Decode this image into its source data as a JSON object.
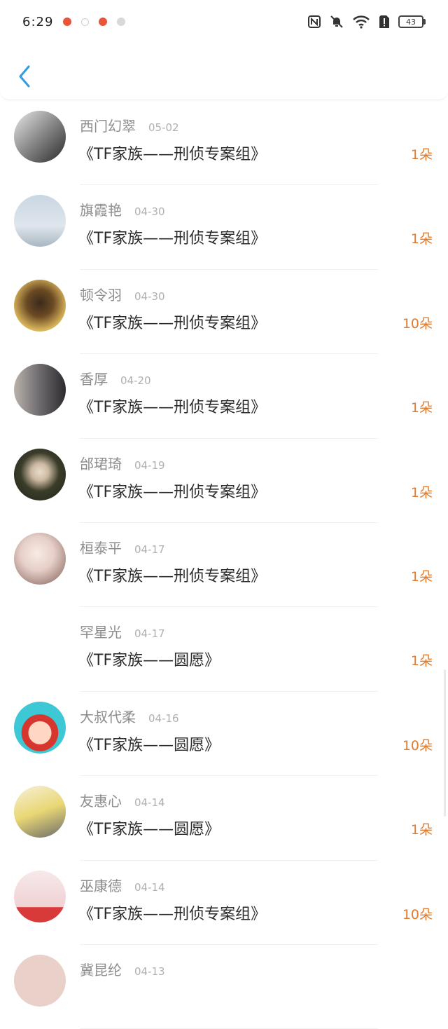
{
  "status_bar": {
    "time": "6:29",
    "battery": "43"
  },
  "entries": [
    {
      "name": "西门幻翠",
      "date": "05-02",
      "title": "《TF家族——刑侦专案组》",
      "count": "1朵",
      "avatar_color": "#3a3a3a",
      "avatar_style": "photo-bw"
    },
    {
      "name": "旗霞艳",
      "date": "04-30",
      "title": "《TF家族——刑侦专案组》",
      "count": "1朵",
      "avatar_color": "#c9d6e3",
      "avatar_style": "sky"
    },
    {
      "name": "顿令羽",
      "date": "04-30",
      "title": "《TF家族——刑侦专案组》",
      "count": "10朵",
      "avatar_color": "#c59a3e",
      "avatar_style": "gold"
    },
    {
      "name": "香厚",
      "date": "04-20",
      "title": "《TF家族——刑侦专案组》",
      "count": "1朵",
      "avatar_color": "#6d6a6e",
      "avatar_style": "street"
    },
    {
      "name": "邰珺琦",
      "date": "04-19",
      "title": "《TF家族——刑侦专案组》",
      "count": "1朵",
      "avatar_color": "#2f3324",
      "avatar_style": "dark"
    },
    {
      "name": "桓泰平",
      "date": "04-17",
      "title": "《TF家族——刑侦专案组》",
      "count": "1朵",
      "avatar_color": "#e8d9d5",
      "avatar_style": "light"
    },
    {
      "name": "罕星光",
      "date": "04-17",
      "title": "《TF家族——圆愿》",
      "count": "1朵",
      "avatar_color": "",
      "avatar_style": "none"
    },
    {
      "name": "大叔代柔",
      "date": "04-16",
      "title": "《TF家族——圆愿》",
      "count": "10朵",
      "avatar_color": "#3ec7d4",
      "avatar_style": "cartoon"
    },
    {
      "name": "友惠心",
      "date": "04-14",
      "title": "《TF家族——圆愿》",
      "count": "1朵",
      "avatar_color": "#f2ecd6",
      "avatar_style": "anime"
    },
    {
      "name": "巫康德",
      "date": "04-14",
      "title": "《TF家族——刑侦专案组》",
      "count": "10朵",
      "avatar_color": "#f3e3e3",
      "avatar_style": "kid"
    },
    {
      "name": "冀昆纶",
      "date": "04-13",
      "title": "",
      "count": "",
      "avatar_color": "#e9d0c8",
      "avatar_style": "partial"
    }
  ],
  "colors": {
    "accent_back": "#2f9be0",
    "count": "#e07a2e"
  }
}
